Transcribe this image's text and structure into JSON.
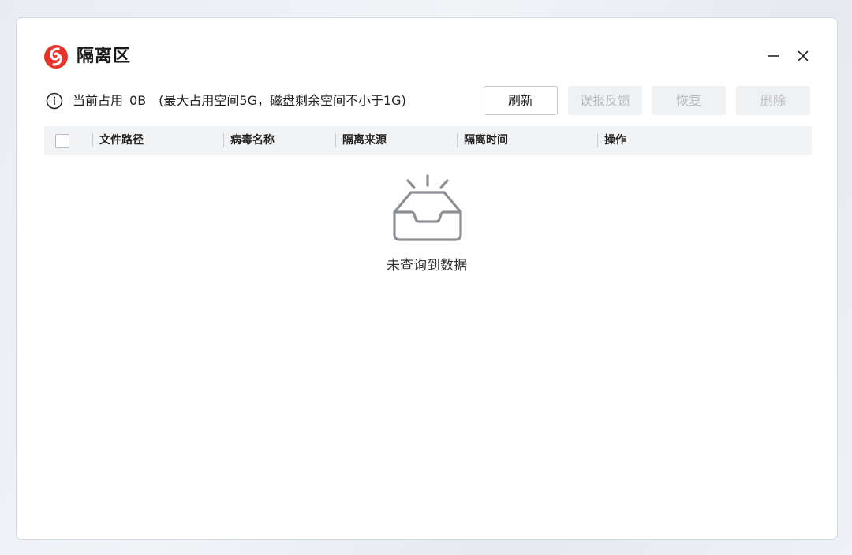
{
  "app": {
    "title": "隔离区",
    "icons": {
      "logo": "antivirus-logo-icon",
      "minimize": "minimize-icon",
      "close": "close-icon",
      "info": "info-icon"
    }
  },
  "usage": {
    "label": "当前占用",
    "value": "0B",
    "note": "(最大占用空间5G，磁盘剩余空间不小于1G)"
  },
  "toolbar": {
    "refresh": "刷新",
    "false_positive": "误报反馈",
    "restore": "恢复",
    "delete": "删除"
  },
  "table": {
    "columns": [
      "文件路径",
      "病毒名称",
      "隔离来源",
      "隔离时间",
      "操作"
    ]
  },
  "empty_state": {
    "icon": "empty-inbox-icon",
    "text": "未查询到数据"
  },
  "colors": {
    "brand": "#e8332a",
    "disabled_bg": "#f0f1f3",
    "disabled_text": "#b7b9bd",
    "header_bg": "#f2f3f5"
  }
}
